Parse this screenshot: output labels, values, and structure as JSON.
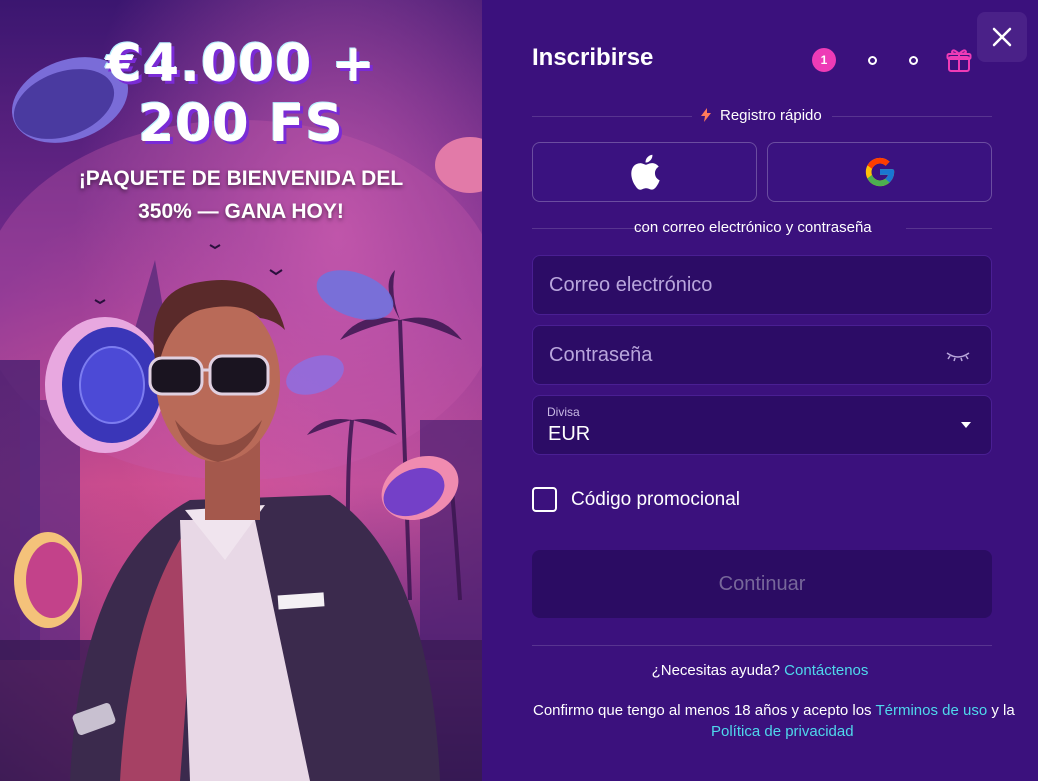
{
  "promo": {
    "headline_line1": "€4.000 +",
    "headline_line2": "200 FS",
    "subline1": "¡PAQUETE DE BIENVENIDA DEL",
    "subline2": "350% — GANA HOY!"
  },
  "form": {
    "title": "Inscribirse",
    "current_step": "1",
    "quick_register_label": "Registro rápido",
    "with_email_label": "con correo electrónico y contraseña",
    "email_placeholder": "Correo electrónico",
    "password_placeholder": "Contraseña",
    "currency_label": "Divisa",
    "currency_value": "EUR",
    "promo_code_label": "Código promocional",
    "continue_label": "Continuar",
    "help_text": "¿Necesitas ayuda?",
    "help_link": "Contáctenos",
    "legal_text": "Confirmo que tengo al menos 18 años y acepto los",
    "terms_link": "Términos de uso",
    "legal_and": "y la",
    "privacy_link": "Política de privacidad"
  },
  "icons": {
    "close": "close-icon",
    "apple": "apple-icon",
    "google": "google-icon",
    "gift": "gift-icon",
    "eye": "eye-closed-icon",
    "bolt": "lightning-icon"
  },
  "colors": {
    "panel_bg": "#3b117d",
    "accent_pink": "#ee3bb6",
    "link": "#4fd8ec"
  }
}
